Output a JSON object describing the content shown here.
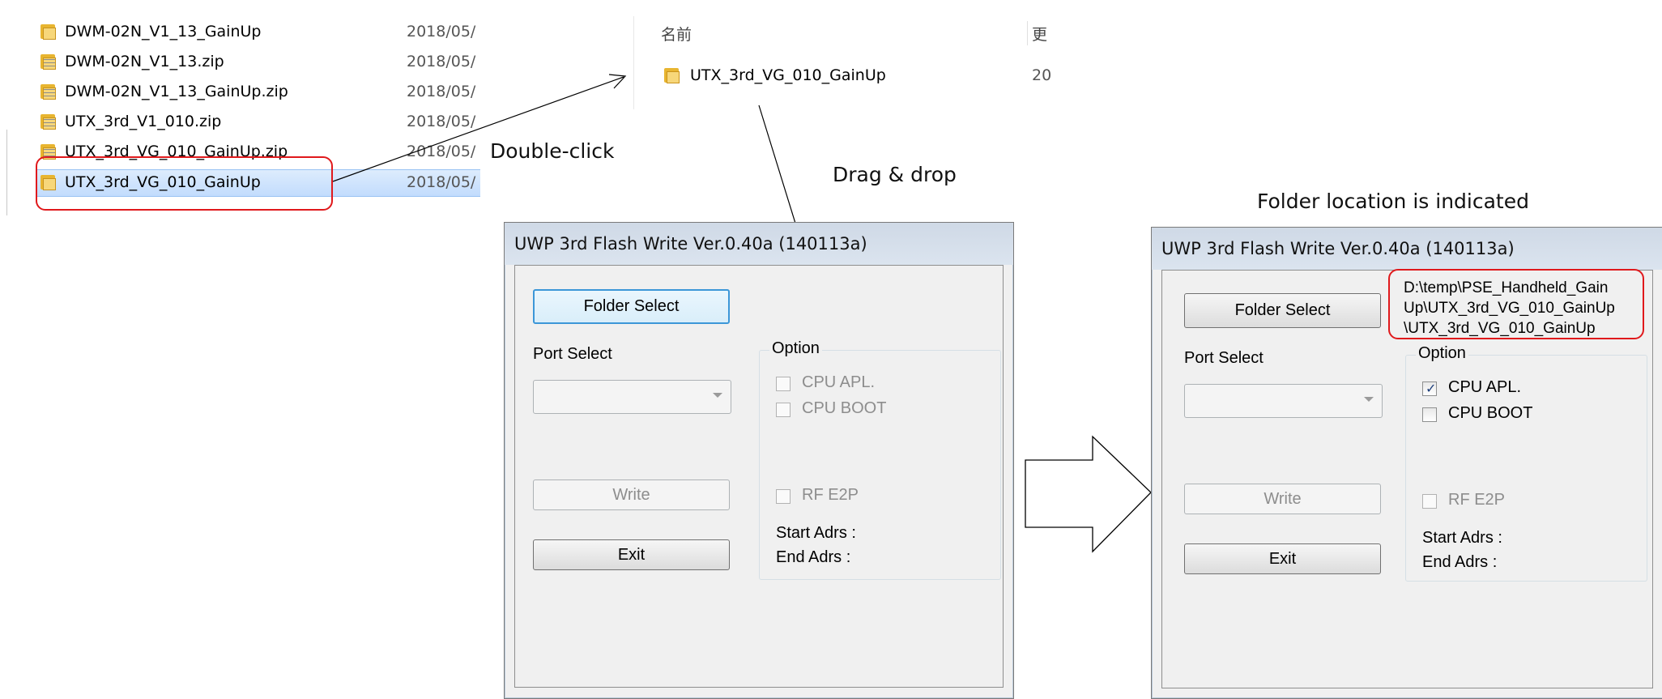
{
  "explorer": {
    "files": [
      {
        "name": "DWM-02N_V1_13_GainUp",
        "date": "2018/05/",
        "icon": "folder-icon"
      },
      {
        "name": "DWM-02N_V1_13.zip",
        "date": "2018/05/",
        "icon": "zip-folder-icon"
      },
      {
        "name": "DWM-02N_V1_13_GainUp.zip",
        "date": "2018/05/",
        "icon": "zip-folder-icon"
      },
      {
        "name": "UTX_3rd_V1_010.zip",
        "date": "2018/05/",
        "icon": "zip-folder-icon"
      },
      {
        "name": "UTX_3rd_VG_010_GainUp.zip",
        "date": "2018/05/",
        "icon": "zip-folder-icon"
      },
      {
        "name": "UTX_3rd_VG_010_GainUp",
        "date": "2018/05/",
        "icon": "folder-icon",
        "selected": true
      }
    ]
  },
  "explorer2": {
    "col_name": "名前",
    "col_date": "更",
    "item_name": "UTX_3rd_VG_010_GainUp",
    "item_date": "20"
  },
  "annotations": {
    "double_click": "Double-click",
    "drag_drop": "Drag & drop",
    "folder_location": "Folder location is indicated"
  },
  "dialog_left": {
    "title": "UWP 3rd Flash Write Ver.0.40a (140113a)",
    "folder_select": "Folder Select",
    "port_select": "Port Select",
    "write": "Write",
    "exit": "Exit",
    "option": "Option",
    "cpu_apl": "CPU APL.",
    "cpu_boot": "CPU BOOT",
    "rf_e2p": "RF E2P",
    "start_adrs": "Start Adrs :",
    "end_adrs": "End Adrs :"
  },
  "dialog_right": {
    "title": "UWP 3rd Flash Write Ver.0.40a (140113a)",
    "folder_select": "Folder Select",
    "port_select": "Port Select",
    "write": "Write",
    "exit": "Exit",
    "option": "Option",
    "cpu_apl": "CPU APL.",
    "cpu_apl_checked": true,
    "cpu_boot": "CPU BOOT",
    "rf_e2p": "RF E2P",
    "start_adrs": "Start Adrs :",
    "end_adrs": "End Adrs :",
    "path_line1": "D:\\temp\\PSE_Handheld_Gain",
    "path_line2": "Up\\UTX_3rd_VG_010_GainUp",
    "path_line3": "\\UTX_3rd_VG_010_GainUp"
  },
  "colors": {
    "highlight_box": "#e0191c",
    "selection": "#c2dcfd",
    "focus_border": "#3c97d8"
  }
}
